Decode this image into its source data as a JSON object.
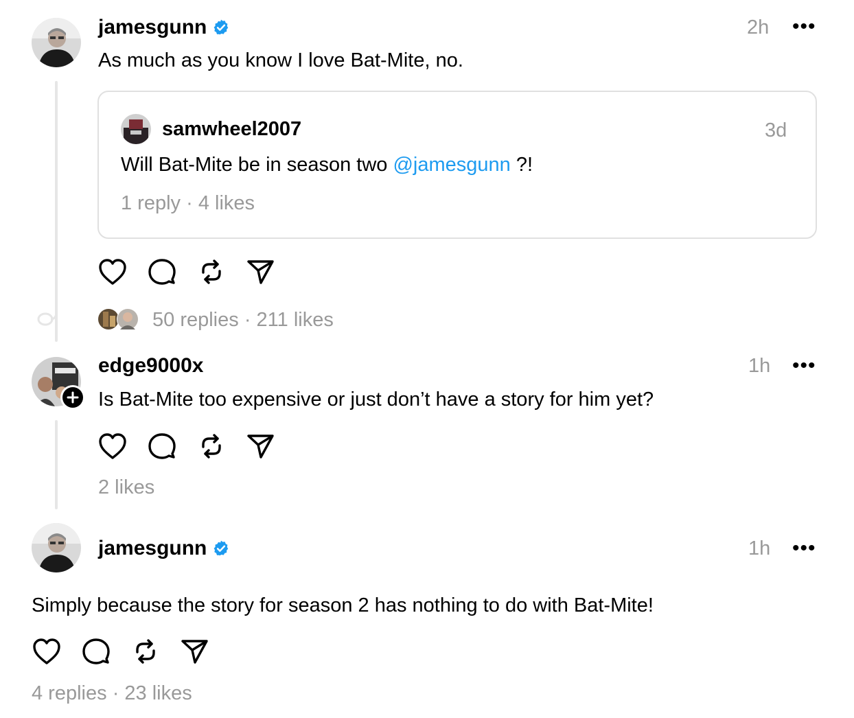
{
  "posts": [
    {
      "username": "jamesgunn",
      "time": "2h",
      "text": "As much as you know I love Bat-Mite, no.",
      "replies_label": "50 replies",
      "likes_label": "211 likes",
      "separator": "·",
      "quote": {
        "username": "samwheel2007",
        "time": "3d",
        "text_before": "Will Bat-Mite be in season two ",
        "mention": "@jamesgunn",
        "text_after": " ?!",
        "replies_label": "1 reply",
        "likes_label": "4 likes",
        "separator": "·"
      }
    },
    {
      "username": "edge9000x",
      "time": "1h",
      "text": "Is Bat-Mite too expensive or just don’t have a story for him yet?",
      "likes_label": "2 likes"
    },
    {
      "username": "jamesgunn",
      "time": "1h",
      "text": "Simply because the story for season 2 has nothing to do with Bat-Mite!",
      "replies_label": "4 replies",
      "likes_label": "23 likes",
      "separator": "·"
    }
  ],
  "more_label": "•••",
  "icons": [
    "heart-icon",
    "comment-icon",
    "repost-icon",
    "share-icon",
    "verified-icon",
    "more-icon",
    "follow-plus-icon"
  ],
  "colors": {
    "verified": "#1d9bf0",
    "mention": "#1d9bf0",
    "muted": "#999999",
    "thread_line": "#e6e6e6"
  }
}
